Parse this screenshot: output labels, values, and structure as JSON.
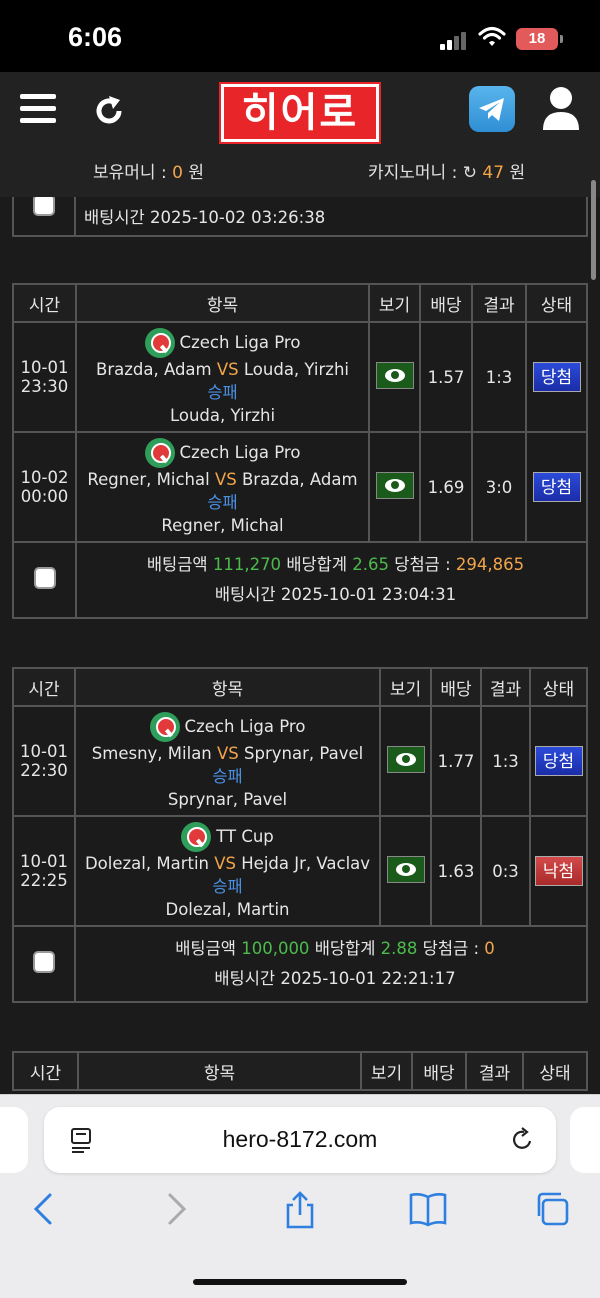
{
  "status": {
    "time": "6:06",
    "battery": "18"
  },
  "header": {
    "logo": "히어로",
    "money_label": "보유머니 :",
    "money_value": "0",
    "money_unit": "원",
    "casino_label": "카지노머니 :",
    "casino_value": "47",
    "casino_unit": "원"
  },
  "columns": {
    "time": "시간",
    "item": "항목",
    "view": "보기",
    "odds": "배당",
    "result": "결과",
    "status": "상태"
  },
  "labels": {
    "bet_amount": "배팅금액",
    "odds_total": "배당합계",
    "winnings": "당첨금 :",
    "bet_time": "배팅시간"
  },
  "top_partial": {
    "bet_time": "2025-10-02 03:26:38"
  },
  "slips": [
    {
      "matches": [
        {
          "date": "10-01",
          "time": "23:30",
          "league": "Czech Liga Pro",
          "home": "Brazda, Adam",
          "away": "Louda, Yirzhi",
          "market": "승패",
          "pick": "Louda, Yirzhi",
          "odds": "1.57",
          "score": "1:3",
          "status": "당첨"
        },
        {
          "date": "10-02",
          "time": "00:00",
          "league": "Czech Liga Pro",
          "home": "Regner, Michal",
          "away": "Brazda, Adam",
          "market": "승패",
          "pick": "Regner, Michal",
          "odds": "1.69",
          "score": "3:0",
          "status": "당첨"
        }
      ],
      "bet_amount": "111,270",
      "odds_total": "2.65",
      "winnings": "294,865",
      "bet_time": "2025-10-01 23:04:31"
    },
    {
      "matches": [
        {
          "date": "10-01",
          "time": "22:30",
          "league": "Czech Liga Pro",
          "home": "Smesny, Milan",
          "away": "Sprynar, Pavel",
          "market": "승패",
          "pick": "Sprynar, Pavel",
          "odds": "1.77",
          "score": "1:3",
          "status": "당첨"
        },
        {
          "date": "10-01",
          "time": "22:25",
          "league": "TT Cup",
          "home": "Dolezal, Martin",
          "away": "Hejda Jr, Vaclav",
          "market": "승패",
          "pick": "Dolezal, Martin",
          "odds": "1.63",
          "score": "0:3",
          "status": "낙첨"
        }
      ],
      "bet_amount": "100,000",
      "odds_total": "2.88",
      "winnings": "0",
      "bet_time": "2025-10-01 22:21:17"
    }
  ],
  "vs": "VS",
  "browser": {
    "url": "hero-8172.com"
  },
  "colors": {
    "win": "#2b4bd8",
    "lose": "#d44a4a",
    "odds": "#4cbb4c",
    "accent": "#f2a54a",
    "logo": "#e8262a"
  }
}
